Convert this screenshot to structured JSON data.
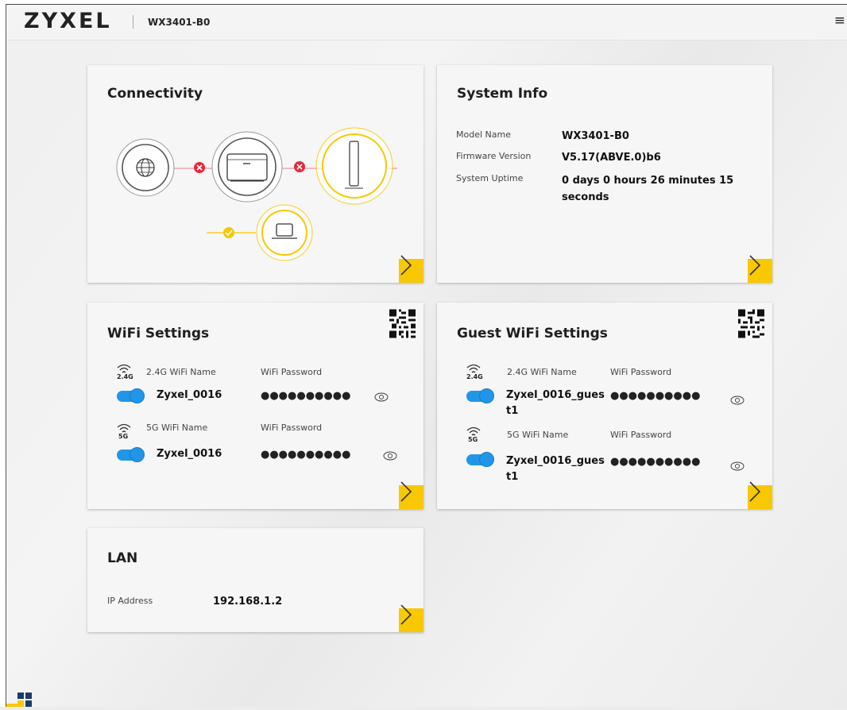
{
  "header": {
    "logo": "ZYXEL",
    "model": "WX3401-B0",
    "menu_icon": "hamburger-icon"
  },
  "connectivity": {
    "title": "Connectivity",
    "nodes": [
      "globe-icon",
      "router-icon",
      "extender-icon",
      "laptop-icon"
    ],
    "status": [
      "disconnected",
      "disconnected",
      "connected"
    ],
    "colors": {
      "error": "#e8293b",
      "ok": "#f8c800",
      "accent": "#f8c800"
    }
  },
  "system_info": {
    "title": "System Info",
    "rows": [
      {
        "label": "Model Name",
        "value": "WX3401-B0"
      },
      {
        "label": "Firmware Version",
        "value": "V5.17(ABVE.0)b6"
      },
      {
        "label": "System Uptime",
        "value": "0 days 0 hours 26 minutes 15",
        "value2": "seconds"
      }
    ]
  },
  "wifi": {
    "title": "WiFi Settings",
    "band24": {
      "badge": "2.4G",
      "name_label": "2.4G WiFi Name",
      "pwd_label": "WiFi Password",
      "name": "Zyxel_0016",
      "password": "●●●●●●●●●●",
      "enabled": true
    },
    "band5": {
      "badge": "5G",
      "name_label": "5G WiFi Name",
      "pwd_label": "WiFi Password",
      "name": "Zyxel_0016",
      "password": "●●●●●●●●●●",
      "enabled": true
    }
  },
  "guest_wifi": {
    "title": "Guest WiFi Settings",
    "band24": {
      "badge": "2.4G",
      "name_label": "2.4G WiFi Name",
      "pwd_label": "WiFi Password",
      "name": "Zyxel_0016_gues",
      "name2": "t1",
      "password": "●●●●●●●●●●",
      "enabled": true
    },
    "band5": {
      "badge": "5G",
      "name_label": "5G WiFi Name",
      "pwd_label": "WiFi Password",
      "name": "Zyxel_0016_gues",
      "name2": "t1",
      "password": "●●●●●●●●●●",
      "enabled": true
    }
  },
  "lan": {
    "title": "LAN",
    "ip_label": "IP Address",
    "ip_value": "192.168.1.2"
  }
}
